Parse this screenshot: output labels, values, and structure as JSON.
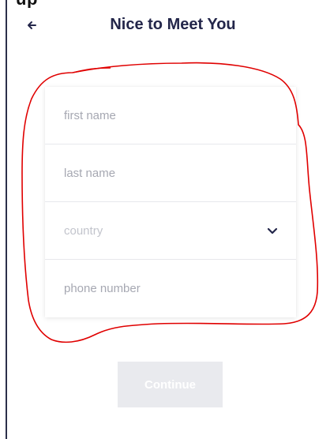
{
  "top_fragment_text": "up",
  "header": {
    "back_icon": "arrow-left-icon",
    "title": "Nice to Meet You"
  },
  "form": {
    "fields": [
      {
        "name": "first-name",
        "placeholder": "first name",
        "value": ""
      },
      {
        "name": "last-name",
        "placeholder": "last name",
        "value": ""
      },
      {
        "name": "country",
        "placeholder": "country",
        "value": "",
        "icon": "chevron-down-icon"
      },
      {
        "name": "phone-number",
        "placeholder": "phone number",
        "value": ""
      }
    ]
  },
  "continue_button": {
    "label": "Continue",
    "enabled": false
  },
  "colors": {
    "title": "#23264a",
    "placeholder": "#a6a8b2",
    "disabled_button_bg": "#e9eaee",
    "annotation": "#e00000"
  }
}
